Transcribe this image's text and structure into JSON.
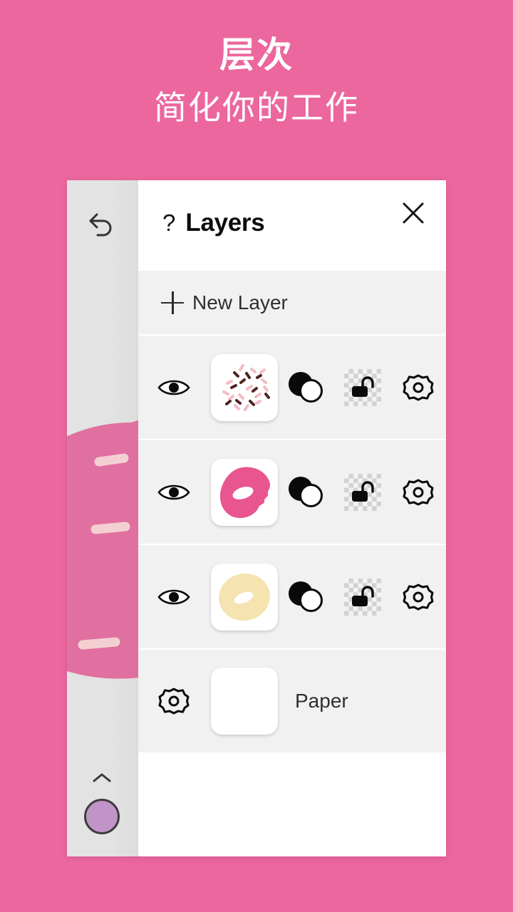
{
  "promo": {
    "title": "层次",
    "subtitle": "简化你的工作",
    "background_color": "#ec679e",
    "text_color": "#ffffff"
  },
  "canvas": {
    "undo_icon": "undo-arrow-icon",
    "expand_icon": "chevron-up-icon",
    "color_swatch_color": "#c194c7",
    "artwork_icing_color": "#e0709f",
    "artwork_sprinkle_light": "#f4cfd2",
    "artwork_sprinkle_dark": "#5a2a28"
  },
  "panel": {
    "help_icon": "question-mark-icon",
    "title": "Layers",
    "close_icon": "close-icon",
    "new_layer": {
      "icon": "plus-icon",
      "label": "New Layer"
    },
    "layers": [
      {
        "name": "sprinkles-layer",
        "visibility_icon": "eye-icon",
        "thumbnail": "sprinkles-thumbnail",
        "blend_icon": "blend-mode-icon",
        "lock_icon": "alpha-lock-icon",
        "settings_icon": "gear-icon"
      },
      {
        "name": "icing-layer",
        "visibility_icon": "eye-icon",
        "thumbnail": "pink-donut-thumbnail",
        "blend_icon": "blend-mode-icon",
        "lock_icon": "alpha-lock-icon",
        "settings_icon": "gear-icon"
      },
      {
        "name": "dough-layer",
        "visibility_icon": "eye-icon",
        "thumbnail": "tan-donut-thumbnail",
        "blend_icon": "blend-mode-icon",
        "lock_icon": "alpha-lock-icon",
        "settings_icon": "gear-icon"
      }
    ],
    "paper": {
      "settings_icon": "gear-icon",
      "thumbnail": "white-paper-thumbnail",
      "label": "Paper"
    }
  },
  "colors": {
    "panel_bg": "#ffffff",
    "row_bg": "#f1f1f1",
    "divider": "#ffffff",
    "icon": "#0a0a0a",
    "icing_pink": "#e8558f",
    "dough_tan": "#f5e3b0"
  }
}
